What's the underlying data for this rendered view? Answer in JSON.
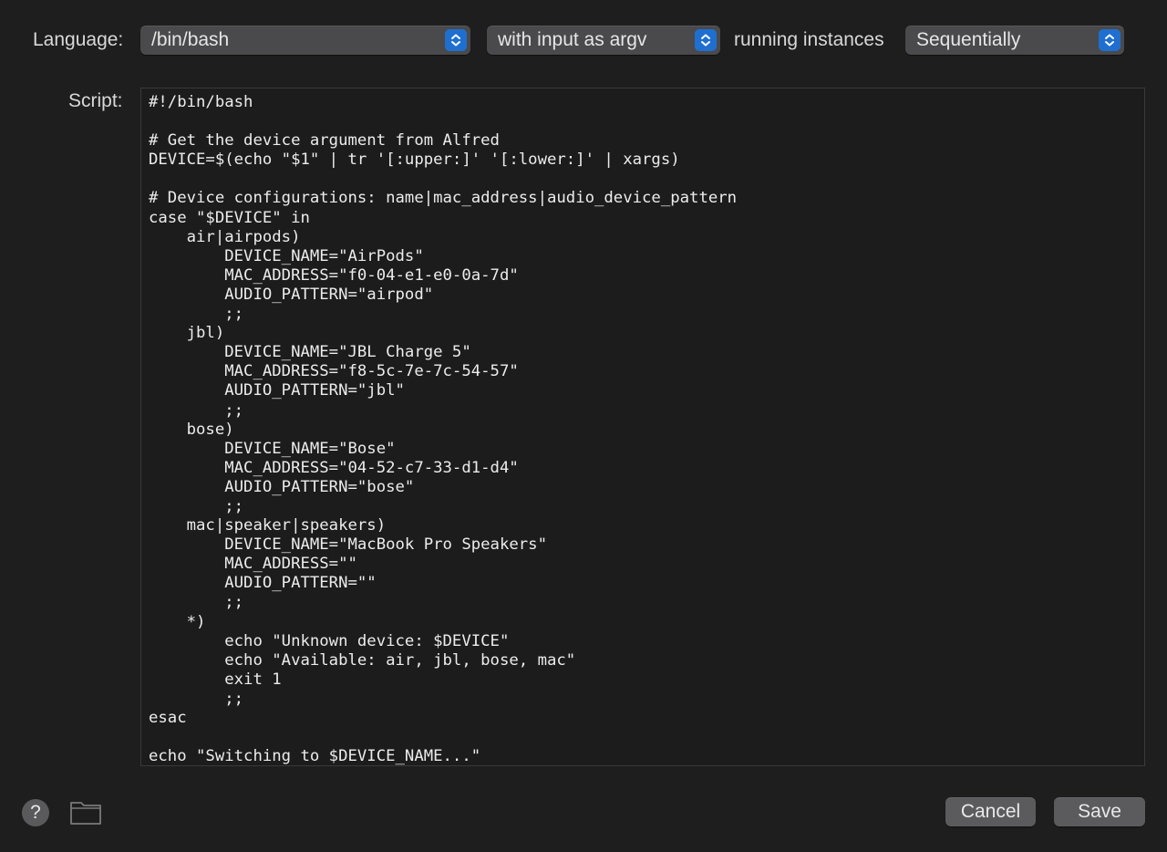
{
  "language_row": {
    "language_label": "Language:",
    "language_value": "/bin/bash",
    "input_mode_value": "with input as argv",
    "running_label": "running instances",
    "running_value": "Sequentially"
  },
  "script": {
    "label": "Script:",
    "lines": [
      "#!/bin/bash",
      "",
      "# Get the device argument from Alfred",
      "DEVICE=$(echo \"$1\" | tr '[:upper:]' '[:lower:]' | xargs)",
      "",
      "# Device configurations: name|mac_address|audio_device_pattern",
      "case \"$DEVICE\" in",
      "    air|airpods)",
      "        DEVICE_NAME=\"AirPods\"",
      "        MAC_ADDRESS=\"f0-04-e1-e0-0a-7d\"",
      "        AUDIO_PATTERN=\"airpod\"",
      "        ;;",
      "    jbl)",
      "        DEVICE_NAME=\"JBL Charge 5\"",
      "        MAC_ADDRESS=\"f8-5c-7e-7c-54-57\"",
      "        AUDIO_PATTERN=\"jbl\"",
      "        ;;",
      "    bose)",
      "        DEVICE_NAME=\"Bose\"",
      "        MAC_ADDRESS=\"04-52-c7-33-d1-d4\"",
      "        AUDIO_PATTERN=\"bose\"",
      "        ;;",
      "    mac|speaker|speakers)",
      "        DEVICE_NAME=\"MacBook Pro Speakers\"",
      "        MAC_ADDRESS=\"\"",
      "        AUDIO_PATTERN=\"\"",
      "        ;;",
      "    *)",
      "        echo \"Unknown device: $DEVICE\"",
      "        echo \"Available: air, jbl, bose, mac\"",
      "        exit 1",
      "        ;;",
      "esac",
      "",
      "echo \"Switching to $DEVICE_NAME...\""
    ]
  },
  "footer": {
    "help_glyph": "?",
    "help_icon": "question-mark-icon",
    "folder_icon": "folder-icon",
    "cancel_label": "Cancel",
    "save_label": "Save"
  },
  "colors": {
    "background": "#1e1e1e",
    "accent": "#1f6fd1",
    "button": "#5b5b5d"
  }
}
